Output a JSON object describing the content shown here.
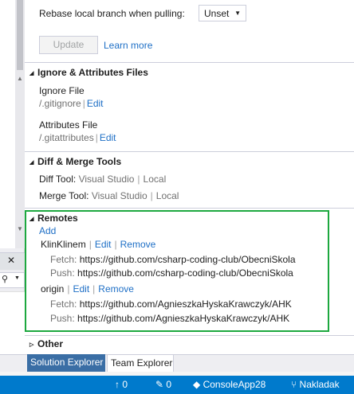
{
  "git_settings": {
    "rebase_label": "Rebase local branch when pulling:",
    "rebase_value": "Unset",
    "update_button": "Update",
    "learn_more": "Learn more"
  },
  "ignore_section": {
    "title": "Ignore & Attributes Files",
    "ignore_label": "Ignore File",
    "ignore_path": "/.gitignore",
    "ignore_edit": "Edit",
    "attributes_label": "Attributes File",
    "attributes_path": "/.gitattributes",
    "attributes_edit": "Edit"
  },
  "diff_section": {
    "title": "Diff & Merge Tools",
    "diff_label": "Diff Tool:",
    "diff_tool": "Visual Studio",
    "diff_local": "Local",
    "merge_label": "Merge Tool:",
    "merge_tool": "Visual Studio",
    "merge_local": "Local"
  },
  "remotes_section": {
    "title": "Remotes",
    "add": "Add",
    "edit": "Edit",
    "remove": "Remove",
    "fetch_label": "Fetch:",
    "push_label": "Push:",
    "remotes": [
      {
        "name": "KlinKlinem",
        "fetch": "https://github.com/csharp-coding-club/ObecniSkola",
        "push": "https://github.com/csharp-coding-club/ObecniSkola"
      },
      {
        "name": "origin",
        "fetch": "https://github.com/AgnieszkaHyskaKrawczyk/AHK",
        "push": "https://github.com/AgnieszkaHyskaKrawczyk/AHK"
      }
    ]
  },
  "other_section": {
    "title": "Other"
  },
  "tabs": {
    "solution_explorer": "Solution Explorer",
    "team_explorer": "Team Explorer"
  },
  "status_bar": {
    "up_count": "0",
    "pencil_count": "0",
    "project": "ConsoleApp28",
    "repo": "Nakladak"
  },
  "colors": {
    "accent": "#007acc",
    "highlight_border": "#1da83f",
    "link": "#1e6fc6"
  }
}
